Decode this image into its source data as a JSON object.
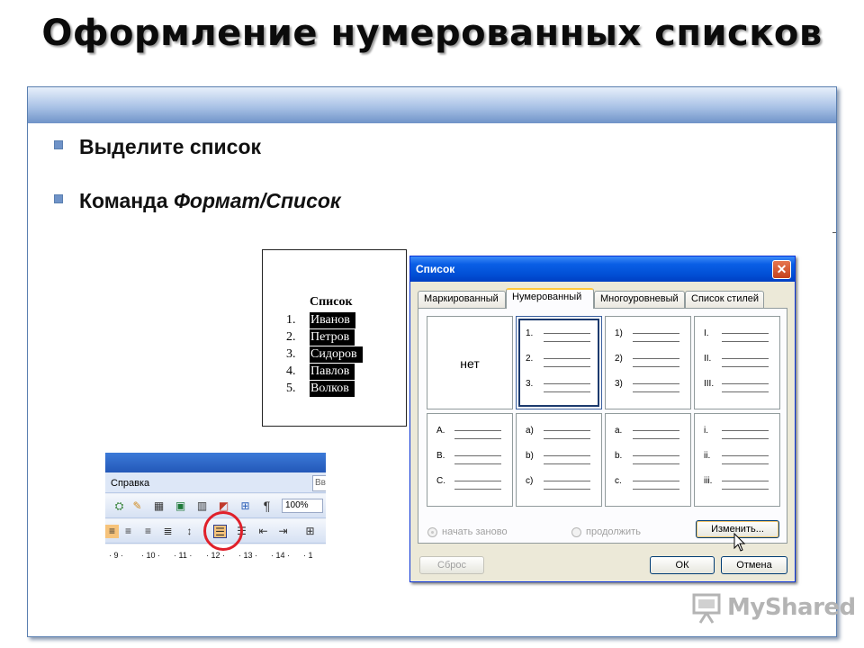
{
  "slide": {
    "title": "Оформление нумерованных списков",
    "bullets": [
      {
        "text": "Выделите список"
      },
      {
        "prefix": "Команда ",
        "italic": "Формат/Список"
      }
    ]
  },
  "document_preview": {
    "heading": "Список",
    "items": [
      {
        "num": "1.",
        "name": "Иванов"
      },
      {
        "num": "2.",
        "name": "Петров"
      },
      {
        "num": "3.",
        "name": "Сидоров"
      },
      {
        "num": "4.",
        "name": "Павлов"
      },
      {
        "num": "5.",
        "name": "Волков"
      }
    ]
  },
  "toolbar": {
    "menu_label": "Справка",
    "corner_text": "Вв",
    "zoom": "100%",
    "pilcrow": "¶",
    "ruler_ticks": [
      "· 9 ·",
      "· 10 ·",
      "· 11 ·",
      "· 12 ·",
      "· 13 ·",
      "· 14 ·",
      "· 1"
    ]
  },
  "dialog": {
    "title": "Список",
    "close_glyph": "✕",
    "tabs": [
      "Маркированный",
      "Нумерованный",
      "Многоуровневый",
      "Список стилей"
    ],
    "active_tab": 1,
    "none_label": "нет",
    "styles": [
      {
        "marks": []
      },
      {
        "marks": [
          "1.",
          "2.",
          "3."
        ]
      },
      {
        "marks": [
          "1)",
          "2)",
          "3)"
        ]
      },
      {
        "marks": [
          "I.",
          "II.",
          "III."
        ]
      },
      {
        "marks": [
          "A.",
          "B.",
          "C."
        ]
      },
      {
        "marks": [
          "a)",
          "b)",
          "c)"
        ]
      },
      {
        "marks": [
          "a.",
          "b.",
          "c."
        ]
      },
      {
        "marks": [
          "i.",
          "ii.",
          "iii."
        ]
      }
    ],
    "radio_restart": "начать заново",
    "radio_continue": "продолжить",
    "change_button": "Изменить...",
    "reset_button": "Сброс",
    "ok_button": "ОК",
    "cancel_button": "Отмена"
  },
  "watermark": {
    "text": "MyShared"
  },
  "colors": {
    "accent": "#6f93c8",
    "dialog_title": "#0150d6",
    "highlight": "#e0202a"
  }
}
